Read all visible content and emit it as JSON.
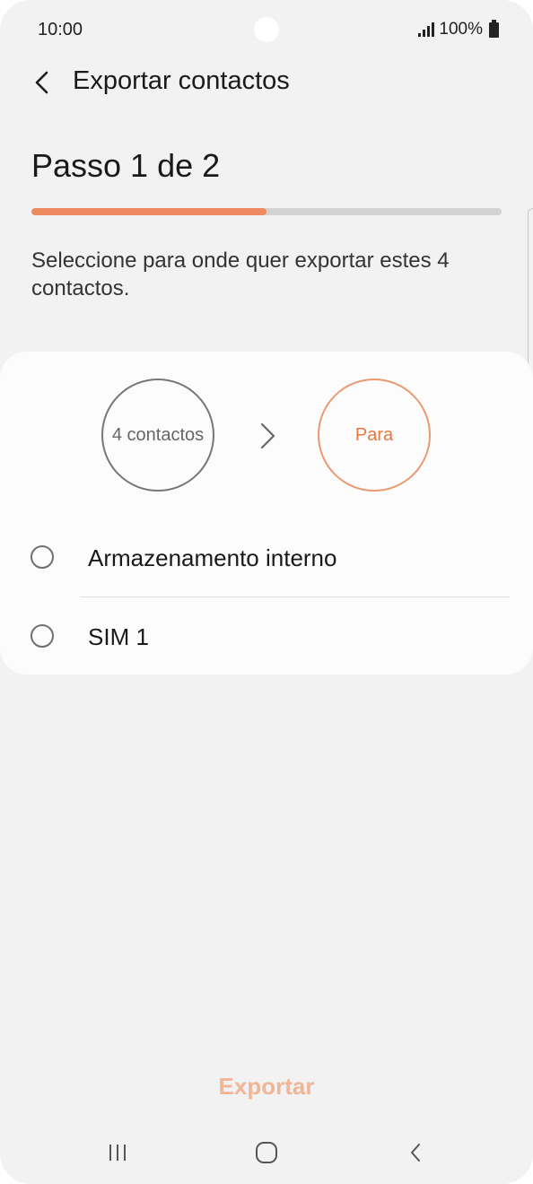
{
  "status_bar": {
    "time": "10:00",
    "battery": "100%"
  },
  "header": {
    "title": "Exportar contactos"
  },
  "step": {
    "title": "Passo 1 de 2",
    "progress": 0.5
  },
  "description": "Seleccione para onde quer exportar estes 4 contactos.",
  "flow": {
    "source": "4 contactos",
    "target": "Para"
  },
  "options": [
    {
      "label": "Armazenamento interno"
    },
    {
      "label": "SIM 1"
    }
  ],
  "export_button": "Exportar",
  "colors": {
    "accent": "#ee8a5f",
    "accent_disabled": "#f0b698",
    "background": "#f2f2f2"
  }
}
